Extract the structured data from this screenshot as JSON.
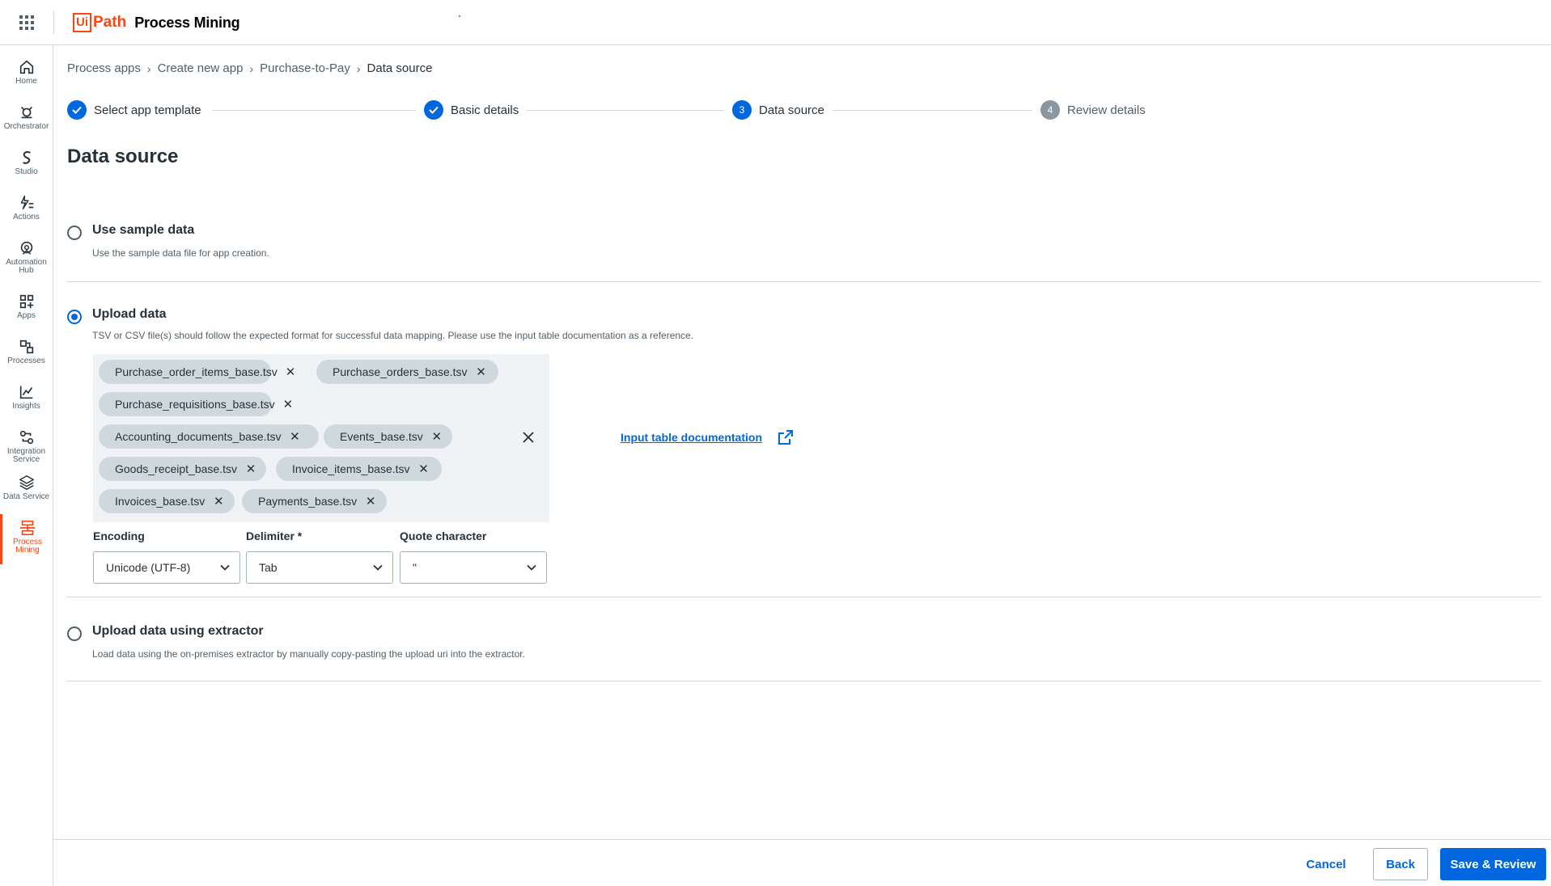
{
  "app": {
    "logo_ui": "Ui",
    "logo_path": "Path",
    "product": "Process Mining"
  },
  "sidebar": {
    "items": [
      {
        "label": "Home",
        "icon": "home-icon"
      },
      {
        "label": "Orchestrator",
        "icon": "orchestrator-icon"
      },
      {
        "label": "Studio",
        "icon": "studio-icon"
      },
      {
        "label": "Actions",
        "icon": "actions-icon"
      },
      {
        "label": "Automation Hub",
        "icon": "automation-hub-icon"
      },
      {
        "label": "Apps",
        "icon": "apps-icon"
      },
      {
        "label": "Processes",
        "icon": "processes-icon"
      },
      {
        "label": "Insights",
        "icon": "insights-icon"
      },
      {
        "label": "Integration Service",
        "icon": "integration-service-icon"
      },
      {
        "label": "Data Service",
        "icon": "data-service-icon"
      },
      {
        "label": "Process Mining",
        "icon": "process-mining-icon",
        "active": true
      }
    ]
  },
  "breadcrumb": [
    "Process apps",
    "Create new app",
    "Purchase-to-Pay",
    "Data source"
  ],
  "stepper": [
    {
      "number": "1",
      "label": "Select app template",
      "state": "done"
    },
    {
      "number": "2",
      "label": "Basic details",
      "state": "done"
    },
    {
      "number": "3",
      "label": "Data source",
      "state": "current"
    },
    {
      "number": "4",
      "label": "Review details",
      "state": "todo"
    }
  ],
  "page_title": "Data source",
  "options": {
    "sample": {
      "title": "Use sample data",
      "description": "Use the sample data file for app creation.",
      "selected": false
    },
    "upload": {
      "title": "Upload data",
      "description": "TSV or CSV file(s) should follow the expected format for successful data mapping. Please use the input table documentation as a reference.",
      "selected": true
    },
    "extractor": {
      "title": "Upload data using extractor",
      "description": "Load data using the on-premises extractor by manually copy-pasting the upload uri into the extractor.",
      "selected": false
    }
  },
  "files": [
    "Purchase_order_items_base.tsv",
    "Purchase_orders_base.tsv",
    "Purchase_requisitions_base.tsv",
    "Accounting_documents_base.tsv",
    "Events_base.tsv",
    "Goods_receipt_base.tsv",
    "Invoice_items_base.tsv",
    "Invoices_base.tsv",
    "Payments_base.tsv"
  ],
  "doc_link": "Input table documentation",
  "fields": {
    "encoding": {
      "label": "Encoding",
      "value": "Unicode (UTF-8)"
    },
    "delimiter": {
      "label": "Delimiter *",
      "value": "Tab"
    },
    "quote": {
      "label": "Quote character",
      "value": "\""
    }
  },
  "footer": {
    "cancel": "Cancel",
    "back": "Back",
    "save": "Save & Review"
  },
  "colors": {
    "accent": "#0067df",
    "brand": "#fa4616"
  }
}
